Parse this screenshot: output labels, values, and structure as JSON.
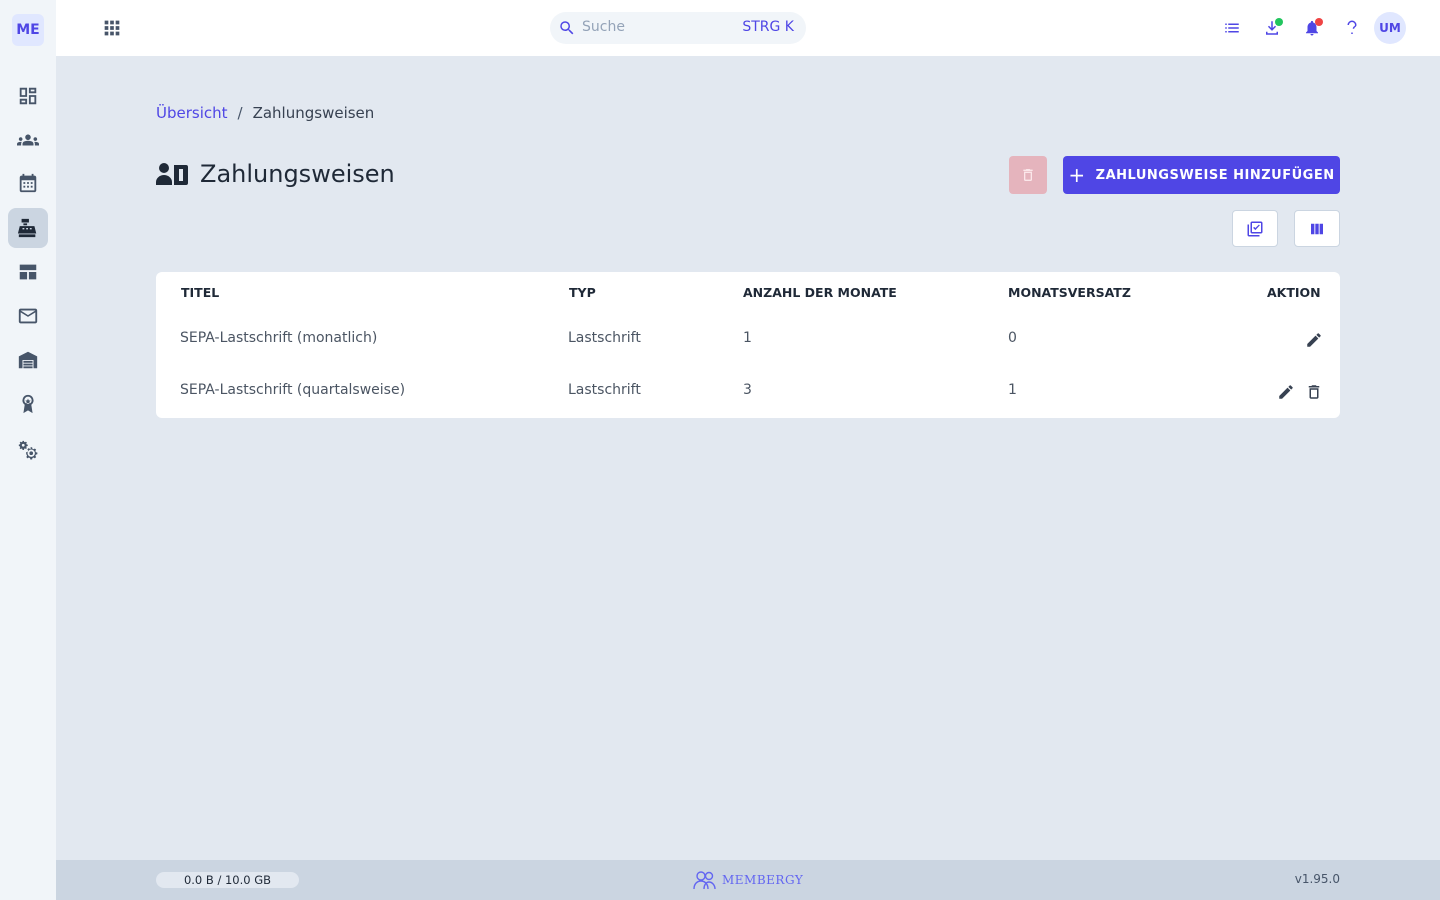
{
  "app": {
    "logo_text": "ME"
  },
  "sidebar": {
    "items": [
      {
        "name": "dashboard",
        "icon": "dashboard-icon"
      },
      {
        "name": "members",
        "icon": "group-icon"
      },
      {
        "name": "calendar",
        "icon": "calendar-icon"
      },
      {
        "name": "cash-register",
        "icon": "cash-register-icon",
        "active": true
      },
      {
        "name": "tables",
        "icon": "table-view-icon"
      },
      {
        "name": "mail",
        "icon": "mail-icon"
      },
      {
        "name": "warehouse",
        "icon": "warehouse-icon"
      },
      {
        "name": "awards",
        "icon": "badge-icon"
      },
      {
        "name": "settings",
        "icon": "settings-icon"
      }
    ]
  },
  "header": {
    "search": {
      "placeholder": "Suche",
      "shortcut": "STRG K"
    },
    "avatar_initials": "UM",
    "colors": {
      "download_dot": "#22c55e",
      "bell_dot": "#ef4444"
    }
  },
  "breadcrumb": {
    "home": "Übersicht",
    "separator": "/",
    "current": "Zahlungsweisen"
  },
  "page": {
    "title": "Zahlungsweisen",
    "add_button_label": "ZAHLUNGSWEISE HINZUFÜGEN",
    "add_button_icon": "+"
  },
  "table": {
    "headers": {
      "title": "TITEL",
      "type": "TYP",
      "months": "ANZAHL DER MONATE",
      "offset": "MONATSVERSATZ",
      "action": "AKTION"
    },
    "rows": [
      {
        "title": "SEPA-Lastschrift (monatlich)",
        "type": "Lastschrift",
        "months": "1",
        "offset": "0",
        "deletable": false
      },
      {
        "title": "SEPA-Lastschrift (quartalsweise)",
        "type": "Lastschrift",
        "months": "3",
        "offset": "1",
        "deletable": true
      }
    ]
  },
  "footer": {
    "storage": "0.0 B / 10.0 GB",
    "brand": "MEMBERGY",
    "version": "v1.95.0"
  },
  "colors": {
    "accent": "#4f46e5",
    "background": "#e2e8f0",
    "delete_disabled": "#e5b4bd"
  }
}
